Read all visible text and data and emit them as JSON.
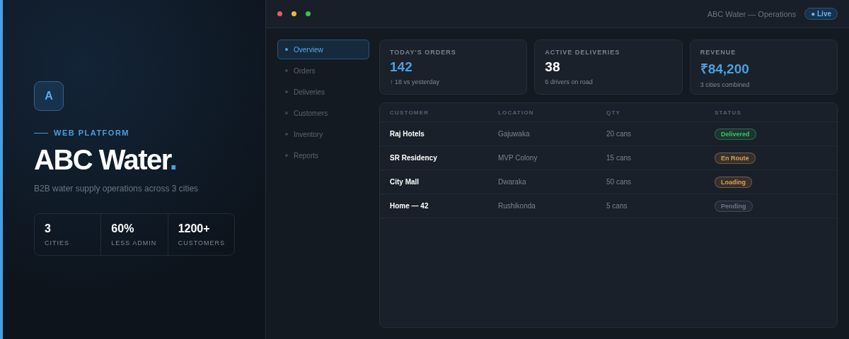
{
  "hero": {
    "logo_letter": "A",
    "eyebrow": "WEB PLATFORM",
    "title": "ABC Water",
    "title_dot": ".",
    "subtitle": "B2B water supply operations across 3 cities",
    "stats": [
      {
        "value": "3",
        "label": "CITIES"
      },
      {
        "value": "60%",
        "label": "LESS ADMIN"
      },
      {
        "value": "1200+",
        "label": "CUSTOMERS"
      }
    ]
  },
  "window": {
    "title": "ABC Water — Operations",
    "badge": "● Live"
  },
  "sidebar": {
    "items": [
      {
        "label": "Overview",
        "selected": true
      },
      {
        "label": "Orders",
        "selected": false
      },
      {
        "label": "Deliveries",
        "selected": false
      },
      {
        "label": "Customers",
        "selected": false
      },
      {
        "label": "Inventory",
        "selected": false
      },
      {
        "label": "Reports",
        "selected": false
      }
    ]
  },
  "cards": [
    {
      "label": "TODAY'S ORDERS",
      "value": "142",
      "note": "↑ 18 vs yesterday",
      "accent": true
    },
    {
      "label": "ACTIVE DELIVERIES",
      "value": "38",
      "note": "6 drivers on road",
      "accent": false
    },
    {
      "label": "REVENUE",
      "value": "₹84,200",
      "note": "3 cities combined",
      "accent": true
    }
  ],
  "table": {
    "columns": [
      "CUSTOMER",
      "LOCATION",
      "QTY",
      "STATUS"
    ],
    "rows": [
      {
        "customer": "Raj Hotels",
        "location": "Gajuwaka",
        "qty": "20 cans",
        "status": "Delivered",
        "color": "#3fbf6a"
      },
      {
        "customer": "SR Residency",
        "location": "MVP Colony",
        "qty": "15 cans",
        "status": "En Route",
        "color": "#e0a050"
      },
      {
        "customer": "City Mall",
        "location": "Dwaraka",
        "qty": "50 cans",
        "status": "Loading",
        "color": "#e0a050"
      },
      {
        "customer": "Home — 42",
        "location": "Rushikonda",
        "qty": "5 cans",
        "status": "Pending",
        "color": "#6b7480"
      }
    ]
  }
}
